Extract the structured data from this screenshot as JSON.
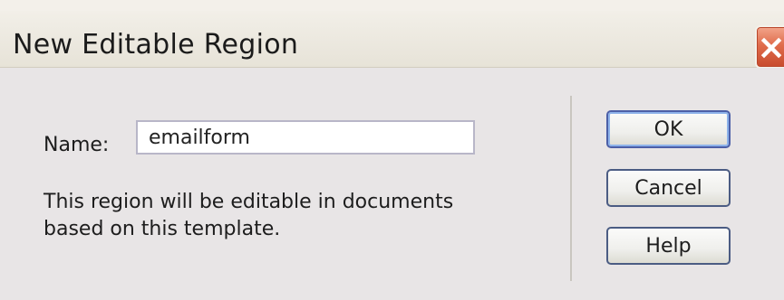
{
  "window": {
    "title": "New Editable Region",
    "close_icon": "×"
  },
  "form": {
    "name_label": "Name:",
    "name_value": "emailform",
    "description": "This region will be editable in documents based on this template."
  },
  "buttons": {
    "ok": "OK",
    "cancel": "Cancel",
    "help": "Help"
  }
}
